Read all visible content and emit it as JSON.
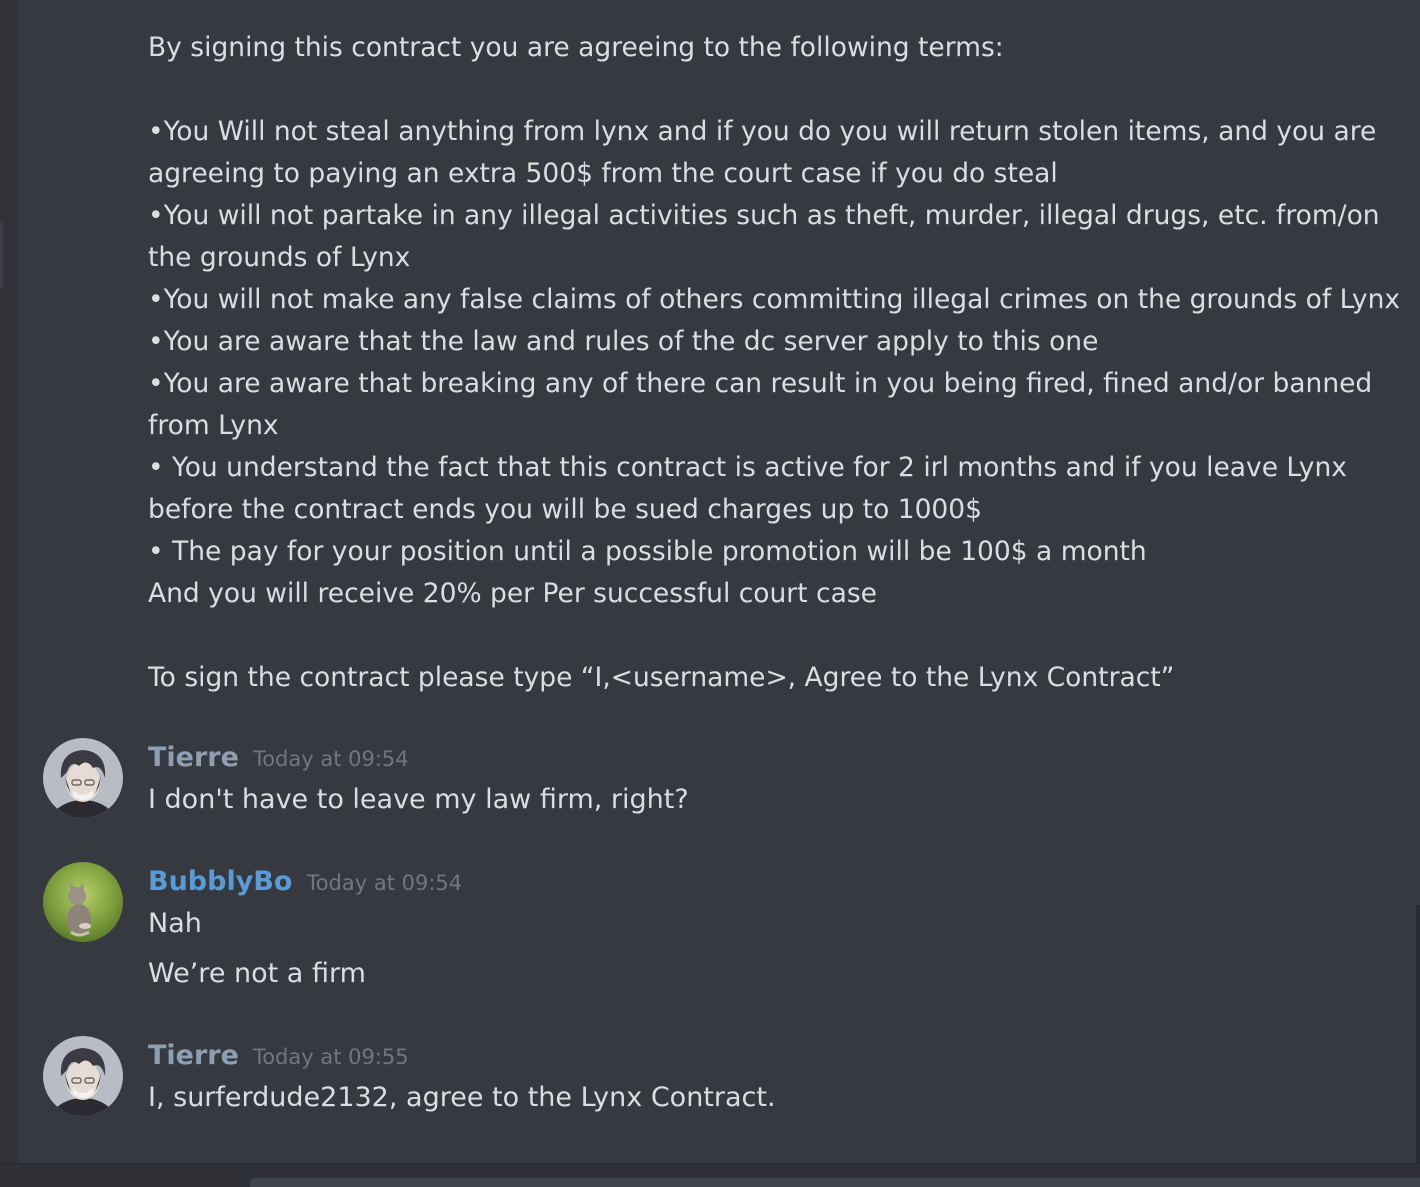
{
  "contract": {
    "lines": [
      "By signing this contract you are agreeing to the following terms:",
      "",
      "•You Will not steal anything from lynx and if you do you will return stolen items, and you are",
      "agreeing to paying an extra 500$ from the court case if you do steal",
      "•You will not partake in any illegal activities such as theft, murder, illegal drugs, etc. from/on",
      "the grounds of Lynx",
      "•You will not make any false claims of others committing illegal crimes on the grounds of Lynx",
      "•You are aware that the law and rules of the dc server apply to this one",
      "•You are aware that breaking any of there can result in you being fired, fined and/or banned",
      "from Lynx",
      "• You understand the fact that this contract is active for 2 irl months and if you leave Lynx",
      "before the contract ends you will be sued charges up to 1000$",
      "• The pay for your position until a possible promotion will be 100$ a month",
      "And you will receive 20% per Per successful court case",
      "",
      "To sign the contract please type “I,<username>, Agree to the Lynx Contract”"
    ]
  },
  "messages": [
    {
      "username": "Tierre",
      "username_color": "#8e9fb3",
      "timestamp": "Today at 09:54",
      "lines": [
        "I don't have to leave my law firm, right?"
      ],
      "avatar": "anime-character-avatar"
    },
    {
      "username": "BubblyBo",
      "username_color": "#5b9bd5",
      "timestamp": "Today at 09:54",
      "lines": [
        "Nah",
        "We’re not a firm"
      ],
      "avatar": "cat-photo-avatar"
    },
    {
      "username": "Tierre",
      "username_color": "#8e9fb3",
      "timestamp": "Today at 09:55",
      "lines": [
        "I, surferdude2132, agree to the Lynx Contract."
      ],
      "avatar": "anime-character-avatar"
    }
  ]
}
